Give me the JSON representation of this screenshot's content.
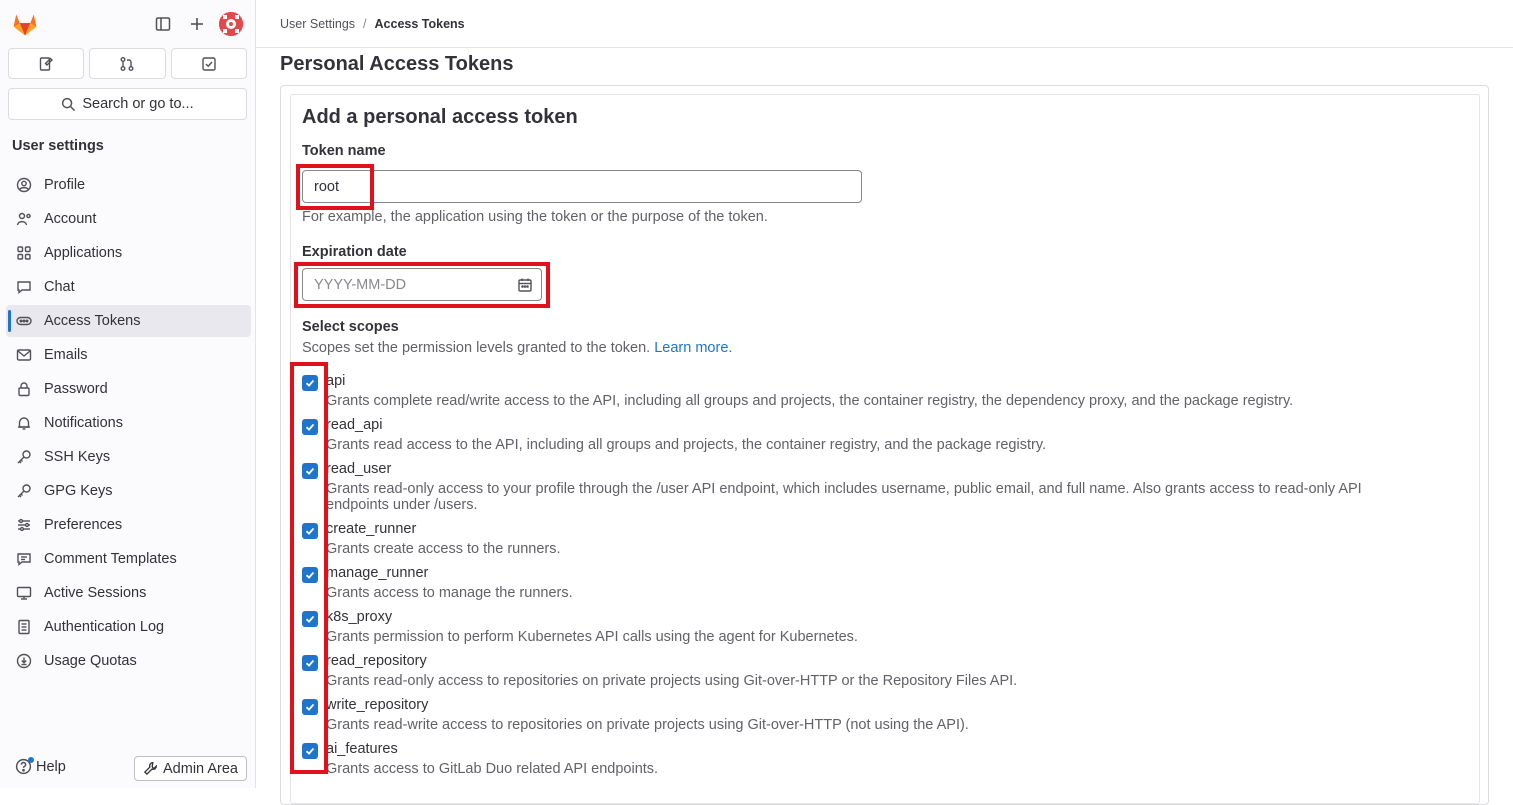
{
  "sidebar": {
    "search_label": "Search or go to...",
    "section_title": "User settings",
    "items": [
      {
        "label": "Profile",
        "icon": "profile-icon"
      },
      {
        "label": "Account",
        "icon": "account-icon"
      },
      {
        "label": "Applications",
        "icon": "applications-icon"
      },
      {
        "label": "Chat",
        "icon": "chat-icon"
      },
      {
        "label": "Access Tokens",
        "icon": "token-icon",
        "active": true
      },
      {
        "label": "Emails",
        "icon": "mail-icon"
      },
      {
        "label": "Password",
        "icon": "lock-icon"
      },
      {
        "label": "Notifications",
        "icon": "bell-icon"
      },
      {
        "label": "SSH Keys",
        "icon": "key-icon"
      },
      {
        "label": "GPG Keys",
        "icon": "key-icon"
      },
      {
        "label": "Preferences",
        "icon": "preferences-icon"
      },
      {
        "label": "Comment Templates",
        "icon": "comment-template-icon"
      },
      {
        "label": "Active Sessions",
        "icon": "monitor-icon"
      },
      {
        "label": "Authentication Log",
        "icon": "log-icon"
      },
      {
        "label": "Usage Quotas",
        "icon": "quota-icon"
      }
    ],
    "help_label": "Help",
    "admin_label": "Admin Area"
  },
  "breadcrumb": {
    "parent": "User Settings",
    "current": "Access Tokens"
  },
  "page": {
    "title": "Personal Access Tokens",
    "form_title": "Add a personal access token",
    "token_name_label": "Token name",
    "token_name_value": "root",
    "token_name_help": "For example, the application using the token or the purpose of the token.",
    "expiration_label": "Expiration date",
    "expiration_placeholder": "YYYY-MM-DD",
    "scopes_label": "Select scopes",
    "scopes_help": "Scopes set the permission levels granted to the token.",
    "learn_more": "Learn more."
  },
  "scopes": [
    {
      "name": "api",
      "checked": true,
      "desc": "Grants complete read/write access to the API, including all groups and projects, the container registry, the dependency proxy, and the package registry."
    },
    {
      "name": "read_api",
      "checked": true,
      "desc": "Grants read access to the API, including all groups and projects, the container registry, and the package registry."
    },
    {
      "name": "read_user",
      "checked": true,
      "desc": "Grants read-only access to your profile through the /user API endpoint, which includes username, public email, and full name. Also grants access to read-only API endpoints under /users."
    },
    {
      "name": "create_runner",
      "checked": true,
      "desc": "Grants create access to the runners."
    },
    {
      "name": "manage_runner",
      "checked": true,
      "desc": "Grants access to manage the runners."
    },
    {
      "name": "k8s_proxy",
      "checked": true,
      "desc": "Grants permission to perform Kubernetes API calls using the agent for Kubernetes."
    },
    {
      "name": "read_repository",
      "checked": true,
      "desc": "Grants read-only access to repositories on private projects using Git-over-HTTP or the Repository Files API."
    },
    {
      "name": "write_repository",
      "checked": true,
      "desc": "Grants read-write access to repositories on private projects using Git-over-HTTP (not using the API)."
    },
    {
      "name": "ai_features",
      "checked": true,
      "desc": "Grants access to GitLab Duo related API endpoints."
    }
  ],
  "colors": {
    "accent": "#1f75cb",
    "highlight": "#e0111b",
    "logo_orange": "#e24329"
  }
}
